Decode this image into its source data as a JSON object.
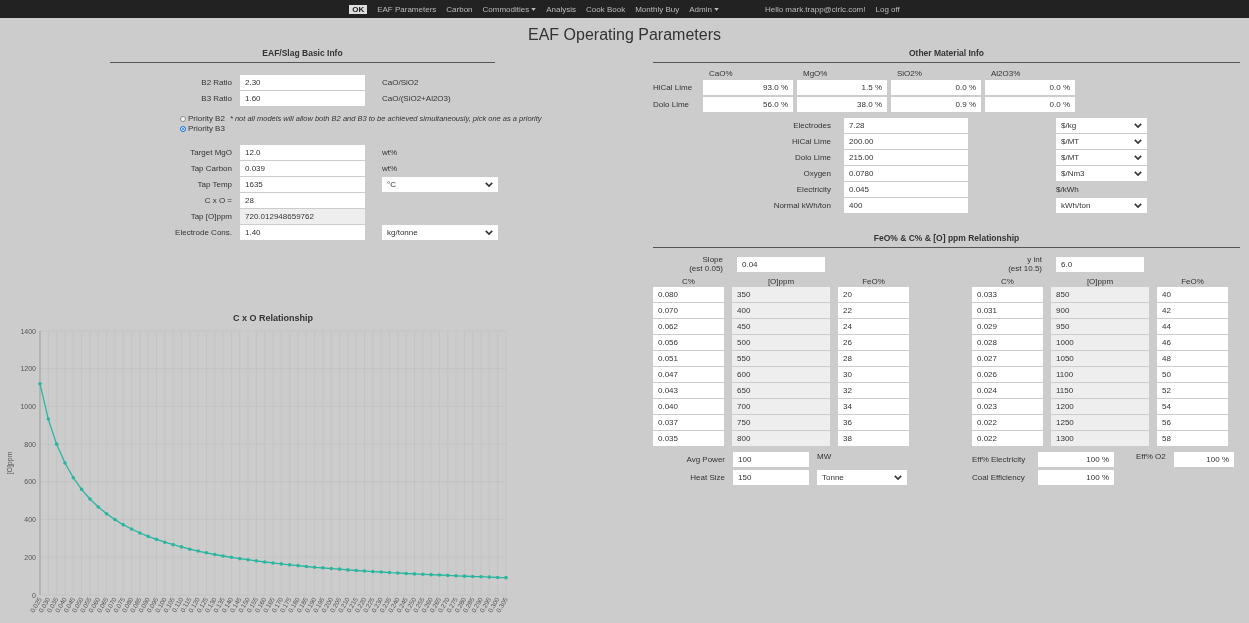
{
  "nav": {
    "logo": "OK",
    "items": [
      {
        "label": "EAF Parameters",
        "dropdown": false
      },
      {
        "label": "Carbon",
        "dropdown": false
      },
      {
        "label": "Commodities",
        "dropdown": true
      },
      {
        "label": "Analysis",
        "dropdown": false
      },
      {
        "label": "Cook Book",
        "dropdown": false
      },
      {
        "label": "Monthly Buy",
        "dropdown": false
      },
      {
        "label": "Admin",
        "dropdown": true
      }
    ],
    "greeting": "Hello mark.trapp@cirlc.com!",
    "logoff": "Log off"
  },
  "page_title": "EAF Operating Parameters",
  "basic_info": {
    "heading": "EAF/Slag Basic Info",
    "ratios": [
      {
        "label": "B2 Ratio",
        "value": "2.30",
        "unit": "CaO/SiO2"
      },
      {
        "label": "B3 Ratio",
        "value": "1.60",
        "unit": "CaO/(SiO2+Al2O3)"
      }
    ],
    "priorities": [
      {
        "label": "Priority B2",
        "selected": false
      },
      {
        "label": "Priority B3",
        "selected": true
      }
    ],
    "note": "* not all models will allow both B2 and B3 to be achieved simultaneously, pick one as a priority",
    "fields": [
      {
        "label": "Target MgO",
        "value": "12.0",
        "readonly": false,
        "suffix": {
          "kind": "text",
          "label": "wt%"
        }
      },
      {
        "label": "Tap Carbon",
        "value": "0.039",
        "readonly": false,
        "suffix": {
          "kind": "text",
          "label": "wt%"
        }
      },
      {
        "label": "Tap Temp",
        "value": "1635",
        "readonly": false,
        "suffix": {
          "kind": "select",
          "label": "°C"
        }
      },
      {
        "label": "C x O =",
        "value": "28",
        "readonly": false
      },
      {
        "label": "Tap [O]ppm",
        "value": "720.012948659762",
        "readonly": true
      },
      {
        "label": "Electrode Cons.",
        "value": "1.40",
        "readonly": false,
        "suffix": {
          "kind": "select",
          "label": "kg/tonne"
        }
      }
    ]
  },
  "chart": {
    "chart_data": {
      "type": "line",
      "title": "C x O Relationship",
      "ylabel": "[O]ppm",
      "grid": true,
      "categories": [
        "0.025",
        "0.030",
        "0.035",
        "0.040",
        "0.045",
        "0.050",
        "0.055",
        "0.060",
        "0.065",
        "0.070",
        "0.075",
        "0.080",
        "0.085",
        "0.090",
        "0.095",
        "0.100",
        "0.105",
        "0.110",
        "0.115",
        "0.120",
        "0.125",
        "0.130",
        "0.135",
        "0.140",
        "0.145",
        "0.150",
        "0.155",
        "0.160",
        "0.165",
        "0.170",
        "0.175",
        "0.180",
        "0.185",
        "0.190",
        "0.195",
        "0.200",
        "0.205",
        "0.210",
        "0.215",
        "0.220",
        "0.225",
        "0.230",
        "0.235",
        "0.240",
        "0.245",
        "0.250",
        "0.255",
        "0.260",
        "0.265",
        "0.270",
        "0.275",
        "0.280",
        "0.285",
        "0.290",
        "0.295",
        "0.300",
        "0.305"
      ],
      "values": [
        1120,
        933,
        800,
        700,
        622,
        560,
        509,
        467,
        431,
        400,
        373,
        350,
        329,
        311,
        295,
        280,
        267,
        255,
        243,
        233,
        224,
        215,
        207,
        200,
        193,
        187,
        181,
        175,
        170,
        165,
        160,
        156,
        151,
        147,
        144,
        140,
        137,
        133,
        130,
        127,
        124,
        122,
        119,
        117,
        114,
        112,
        110,
        108,
        106,
        104,
        102,
        100,
        98,
        97,
        95,
        93,
        92
      ],
      "ylim": [
        0,
        1400
      ],
      "yticks": [
        0,
        200,
        400,
        600,
        800,
        1000,
        1200,
        1400
      ]
    }
  },
  "other_material": {
    "heading": "Other Material Info",
    "columns": [
      "CaO%",
      "MgO%",
      "SiO2%",
      "Al2O3%"
    ],
    "rows": [
      {
        "label": "HiCal Lime",
        "values": [
          "93.0 %",
          "1.5 %",
          "0.0 %",
          "0.0 %"
        ]
      },
      {
        "label": "Dolo Lime",
        "values": [
          "56.0 %",
          "38.0 %",
          "0.9 %",
          "0.0 %"
        ]
      }
    ],
    "costs": [
      {
        "label": "Electrodes",
        "value": "7.28",
        "unit": {
          "kind": "select",
          "label": "$/kg"
        }
      },
      {
        "label": "HiCal Lime",
        "value": "200.00",
        "unit": {
          "kind": "select",
          "label": "$/MT"
        }
      },
      {
        "label": "Dolo Lime",
        "value": "215.00",
        "unit": {
          "kind": "select",
          "label": "$/MT"
        }
      },
      {
        "label": "Oxygen",
        "value": "0.0780",
        "unit": {
          "kind": "select",
          "label": "$/Nm3"
        }
      },
      {
        "label": "Electricity",
        "value": "0.045",
        "unit": {
          "kind": "text",
          "label": "$/kWh"
        }
      },
      {
        "label": "Normal kWh/ton",
        "value": "400",
        "unit": {
          "kind": "select",
          "label": "kWh/ton"
        }
      }
    ]
  },
  "feo_relationship": {
    "heading": "FeO% & C% & [O] ppm Relationship",
    "tables": [
      {
        "param": {
          "label": "Slope",
          "hint": "(est 0.05)",
          "value": "0.04"
        },
        "columns": [
          "C%",
          "[O]ppm",
          "FeO%"
        ],
        "rows": [
          [
            "0.080",
            "350",
            "20"
          ],
          [
            "0.070",
            "400",
            "22"
          ],
          [
            "0.062",
            "450",
            "24"
          ],
          [
            "0.056",
            "500",
            "26"
          ],
          [
            "0.051",
            "550",
            "28"
          ],
          [
            "0.047",
            "600",
            "30"
          ],
          [
            "0.043",
            "650",
            "32"
          ],
          [
            "0.040",
            "700",
            "34"
          ],
          [
            "0.037",
            "750",
            "36"
          ],
          [
            "0.035",
            "800",
            "38"
          ]
        ]
      },
      {
        "param": {
          "label": "y int",
          "hint": "(est 10.5)",
          "value": "6.0"
        },
        "columns": [
          "C%",
          "[O]ppm",
          "FeO%"
        ],
        "rows": [
          [
            "0.033",
            "850",
            "40"
          ],
          [
            "0.031",
            "900",
            "42"
          ],
          [
            "0.029",
            "950",
            "44"
          ],
          [
            "0.028",
            "1000",
            "46"
          ],
          [
            "0.027",
            "1050",
            "48"
          ],
          [
            "0.026",
            "1100",
            "50"
          ],
          [
            "0.024",
            "1150",
            "52"
          ],
          [
            "0.023",
            "1200",
            "54"
          ],
          [
            "0.022",
            "1250",
            "56"
          ],
          [
            "0.022",
            "1300",
            "58"
          ]
        ]
      }
    ],
    "power": [
      {
        "label": "Avg Power",
        "value": "100",
        "unit": {
          "kind": "text",
          "label": "MW"
        }
      },
      {
        "label": "Heat Size",
        "value": "150",
        "unit": {
          "kind": "select",
          "label": "Tonne"
        }
      }
    ],
    "efficiency": [
      {
        "label": "Eff% Electricity",
        "value": "100 %"
      },
      {
        "label": "Coal Efficiency",
        "value": "100 %"
      }
    ],
    "o2": {
      "label": "Eff% O2",
      "value": "100 %"
    }
  }
}
